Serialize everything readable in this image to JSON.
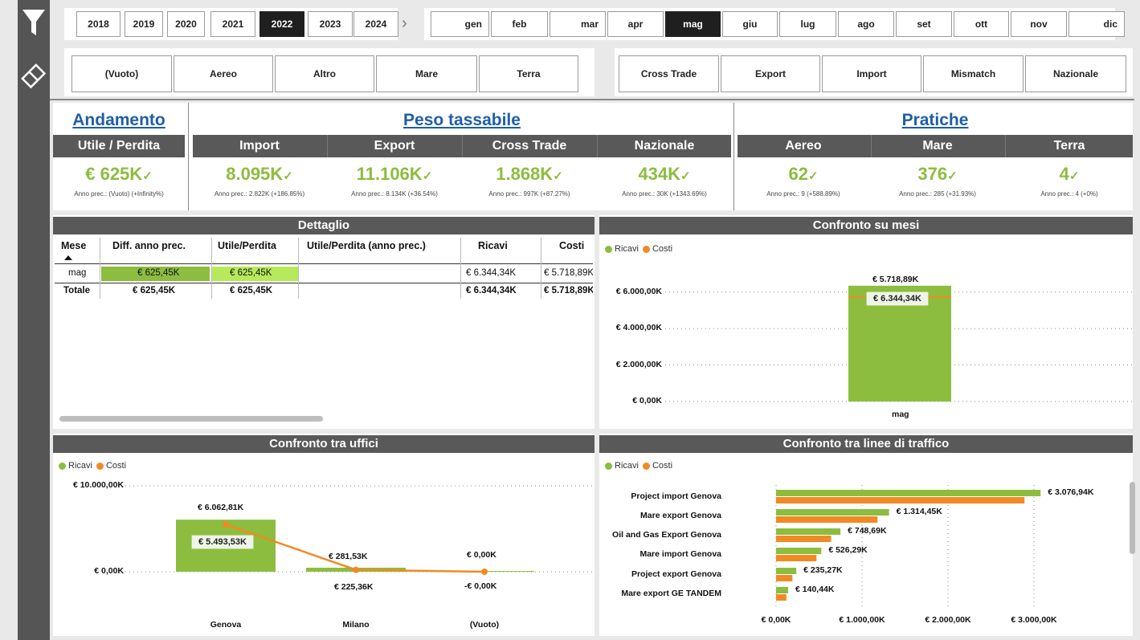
{
  "years": [
    "2018",
    "2019",
    "2020",
    "2021",
    "2022",
    "2023",
    "2024"
  ],
  "selected_year": "2022",
  "months": [
    "gen",
    "feb",
    "mar",
    "apr",
    "mag",
    "giu",
    "lug",
    "ago",
    "set",
    "ott",
    "nov",
    "dic"
  ],
  "selected_month": "mag",
  "next_arrow": "›",
  "transport_types": [
    "(Vuoto)",
    "Aereo",
    "Altro",
    "Mare",
    "Terra"
  ],
  "trade_types": [
    "Cross Trade",
    "Export",
    "Import",
    "Mismatch",
    "Nazionale"
  ],
  "kpi": {
    "andamento": {
      "title": "Andamento",
      "head": "Utile / Perdita",
      "value": "€ 625K",
      "sub": "Anno prec.: (Vuoto) (+Infinity%)"
    },
    "peso": {
      "title": "Peso tassabile",
      "cols": [
        {
          "head": "Import",
          "value": "8.095K",
          "sub": "Anno prec.: 2.822K (+186.85%)"
        },
        {
          "head": "Export",
          "value": "11.106K",
          "sub": "Anno prec.: 8.134K (+36.54%)"
        },
        {
          "head": "Cross Trade",
          "value": "1.868K",
          "sub": "Anno prec.: 997K (+87.27%)"
        },
        {
          "head": "Nazionale",
          "value": "434K",
          "sub": "Anno prec.: 30K (+1343.69%)"
        }
      ]
    },
    "pratiche": {
      "title": "Pratiche",
      "cols": [
        {
          "head": "Aereo",
          "value": "62",
          "sub": "Anno prec.: 9 (+588.89%)"
        },
        {
          "head": "Mare",
          "value": "376",
          "sub": "Anno prec.: 285 (+31.93%)"
        },
        {
          "head": "Terra",
          "value": "4",
          "sub": "Anno prec.: 4 (+0%)"
        }
      ]
    },
    "check": "✓"
  },
  "dettaglio": {
    "title": "Dettaglio",
    "headers": [
      "Mese",
      "Diff. anno prec.",
      "Utile/Perdita",
      "Utile/Perdita (anno prec.)",
      "Ricavi",
      "Costi"
    ],
    "rows": [
      {
        "mese": "mag",
        "diff": "€ 625,45K",
        "utile": "€ 625,45K",
        "utile_prec": "",
        "ricavi": "€ 6.344,34K",
        "costi": "€ 5.718,89K"
      }
    ],
    "total": {
      "mese": "Totale",
      "diff": "€ 625,45K",
      "utile": "€ 625,45K",
      "utile_prec": "",
      "ricavi": "€ 6.344,34K",
      "costi": "€ 5.718,89K"
    }
  },
  "legend": {
    "ricavi": "Ricavi",
    "costi": "Costi",
    "ricavi_color": "#8cbd3f",
    "costi_color": "#f08a24"
  },
  "chart_data": [
    {
      "type": "bar",
      "title": "Confronto su mesi",
      "categories": [
        "mag"
      ],
      "series": [
        {
          "name": "Ricavi",
          "values": [
            6344.34
          ]
        },
        {
          "name": "Costi",
          "values": [
            5718.89
          ]
        }
      ],
      "value_labels": {
        "ricavi": "€ 6.344,34K",
        "costi": "€ 5.718,89K"
      },
      "ytick_labels": [
        "€ 6.000,00K",
        "€ 4.000,00K",
        "€ 2.000,00K",
        "€ 0,00K"
      ],
      "yticks": [
        6000,
        4000,
        2000,
        0
      ],
      "ylim": [
        0,
        6600
      ],
      "legend": "top-left",
      "grid": true
    },
    {
      "type": "bar",
      "title": "Confronto tra uffici",
      "categories": [
        "Genova",
        "Milano",
        "(Vuoto)"
      ],
      "series": [
        {
          "name": "Ricavi",
          "values": [
            6062.81,
            281.53,
            0
          ]
        },
        {
          "name": "Costi",
          "values": [
            5493.53,
            225.36,
            0
          ]
        }
      ],
      "ricavi_labels": [
        "€ 6.062,81K",
        "€ 281,53K",
        "€ 0,00K"
      ],
      "costi_labels": [
        "€ 5.493,53K",
        "€ 225,36K",
        "-€ 0,00K"
      ],
      "ytick_labels": [
        "€ 10.000,00K",
        "€ 0,00K"
      ],
      "yticks": [
        10000,
        0
      ],
      "legend": "top-left",
      "grid": true
    },
    {
      "type": "bar",
      "title": "Confronto tra linee di traffico",
      "categories": [
        "Project import Genova",
        "Mare export Genova",
        "Oil and Gas Export Genova",
        "Mare import Genova",
        "Project export Genova",
        "Mare export GE TANDEM"
      ],
      "series": [
        {
          "name": "Ricavi",
          "values": [
            3076.94,
            1314.45,
            748.69,
            526.29,
            235.27,
            140.44
          ]
        },
        {
          "name": "Costi",
          "values": [
            2890,
            1180,
            640,
            470,
            190,
            120
          ]
        }
      ],
      "value_labels": [
        "€ 3.076,94K",
        "€ 1.314,45K",
        "€ 748,69K",
        "€ 526,29K",
        "€ 235,27K",
        "€ 140,44K"
      ],
      "xtick_labels": [
        "€ 0,00K",
        "€ 1.000,00K",
        "€ 2.000,00K",
        "€ 3.000,00K"
      ],
      "xticks": [
        0,
        1000,
        2000,
        3000
      ],
      "xlim": [
        0,
        3300
      ],
      "legend": "top-left",
      "grid": true
    }
  ]
}
